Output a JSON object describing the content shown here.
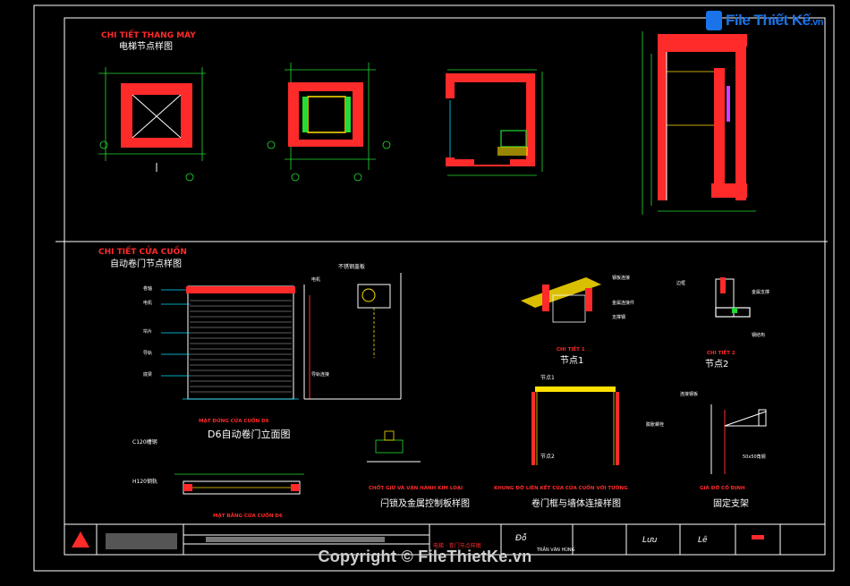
{
  "watermark": {
    "logo_text": "File Thiết Kế",
    "logo_suffix": ".vn",
    "copyright": "Copyright © FileThietKe.vn"
  },
  "sections": {
    "elevator_title_vn": "CHI TIẾT THANG MÁY",
    "elevator_title_cn": "电梯节点样图",
    "door_title_vn": "CHI TIẾT CỬA CUỐN",
    "door_title_cn": "自动卷门节点样图"
  },
  "drawings": {
    "door_elev_caption_vn": "MẶT ĐỨNG CỬA CUỐN D6",
    "door_elev_caption_cn": "D6自动卷门立面图",
    "door_plan_caption_vn": "MẶT BẰNG CỬA CUỐN D6",
    "node1_caption_vn": "CHI TIẾT 1",
    "node1_caption_cn": "节点1",
    "node2_caption_vn": "CHI TIẾT 2",
    "node2_caption_cn": "节点2",
    "joint_caption_vn": "CHỐT GIỮ VÀ VẬN HÀNH KIM LOẠI",
    "joint_caption_cn": "闩锁及金属控制板样图",
    "frame_caption_vn": "KHUNG ĐỠ LIÊN KẾT CỦA CỬA CUỐN VỚI TƯỜNG",
    "frame_caption_cn": "卷门框与墙体连接样图",
    "bracket_caption_vn": "GIÁ ĐỠ CỐ ĐỊNH",
    "bracket_caption_cn": "固定支架",
    "node1_label": "节点1",
    "node2_label": "节点2",
    "label_c120": "C120槽钢",
    "label_h120": "H120钢轨",
    "label_note_top": "不锈钢盖板",
    "label_left_1": "卷轴",
    "label_left_2": "电机",
    "label_left_3": "帘片",
    "label_left_4": "导轨",
    "label_left_5": "底梁",
    "label_right_1": "电机",
    "label_right_2": "导轨连接",
    "label_n1_1": "钢板连接",
    "label_n1_2": "金属连接件",
    "label_n1_3": "支撑钢",
    "label_n2_1": "边框",
    "label_n2_2": "金属支撑",
    "label_n2_3": "钢结构",
    "label_br_1": "连接钢板",
    "label_br_2": "膨胀螺栓",
    "label_br_3": "50x50角钢"
  },
  "title_block": {
    "drawing_name": "电梯 · 卷门节点样图",
    "signer_1": "Đỗ",
    "signer_2": "TRẦN VĂN HÙNG",
    "signer_3": "Lưu",
    "signer_4": "Lê"
  },
  "colors": {
    "background": "#000000",
    "wall": "#ff2a2a",
    "dimension": "#22dd33",
    "note": "#00e0ff",
    "detail": "#ffe000",
    "linework": "#ffffff"
  }
}
